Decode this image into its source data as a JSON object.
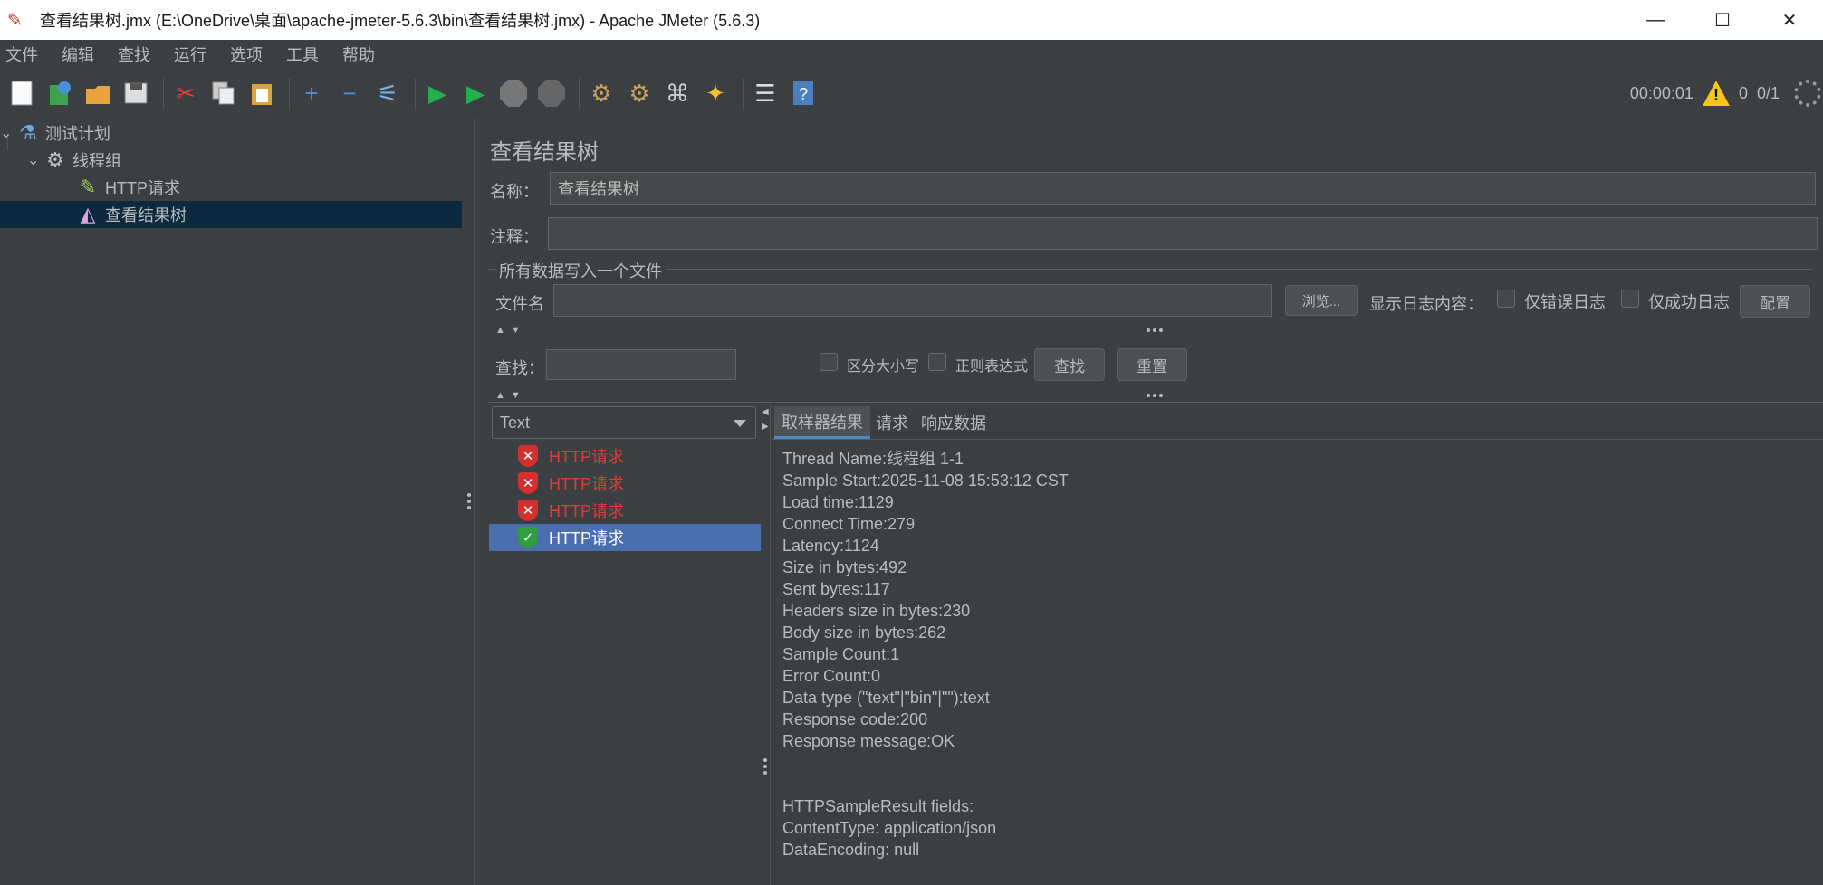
{
  "window": {
    "title": "查看结果树.jmx (E:\\OneDrive\\桌面\\apache-jmeter-5.6.3\\bin\\查看结果树.jmx) - Apache JMeter (5.6.3)",
    "minimize": "—",
    "maximize": "☐",
    "close": "✕"
  },
  "menu": [
    "文件",
    "编辑",
    "查找",
    "运行",
    "选项",
    "工具",
    "帮助"
  ],
  "status": {
    "elapsed": "00:00:01",
    "warnings": "0",
    "threads": "0/1"
  },
  "tree": {
    "items": [
      {
        "label": "测试计划",
        "icon": "flask-icon"
      },
      {
        "label": "线程组",
        "icon": "gear-icon"
      },
      {
        "label": "HTTP请求",
        "icon": "pipette-icon"
      },
      {
        "label": "查看结果树",
        "icon": "chart-icon"
      }
    ]
  },
  "panel": {
    "title": "查看结果树",
    "name_label": "名称：",
    "name_value": "查看结果树",
    "comment_label": "注释：",
    "comment_value": "",
    "file_section": "所有数据写入一个文件",
    "filename_label": "文件名",
    "filename_value": "",
    "browse_button": "浏览...",
    "log_content_label": "显示日志内容：",
    "errors_only": "仅错误日志",
    "success_only": "仅成功日志",
    "configure_button": "配置",
    "search_label": "查找：",
    "search_value": "",
    "case_sensitive": "区分大小写",
    "regex": "正则表达式",
    "find_button": "查找",
    "reset_button": "重置",
    "renderer": "Text"
  },
  "results": [
    {
      "label": "HTTP请求",
      "status": "error",
      "color": "#e53935"
    },
    {
      "label": "HTTP请求",
      "status": "error",
      "color": "#e53935"
    },
    {
      "label": "HTTP请求",
      "status": "error",
      "color": "#e53935"
    },
    {
      "label": "HTTP请求",
      "status": "success",
      "color": "#ffffff"
    }
  ],
  "tabs": [
    "取样器结果",
    "请求",
    "响应数据"
  ],
  "sampler_result": [
    "Thread Name:线程组 1-1",
    "Sample Start:2025-11-08 15:53:12 CST",
    "Load time:1129",
    "Connect Time:279",
    "Latency:1124",
    "Size in bytes:492",
    "Sent bytes:117",
    "Headers size in bytes:230",
    "Body size in bytes:262",
    "Sample Count:1",
    "Error Count:0",
    "Data type (\"text\"|\"bin\"|\"\"):text",
    "Response code:200",
    "Response message:OK",
    "",
    "",
    "HTTPSampleResult fields:",
    "ContentType: application/json",
    "DataEncoding: null"
  ]
}
